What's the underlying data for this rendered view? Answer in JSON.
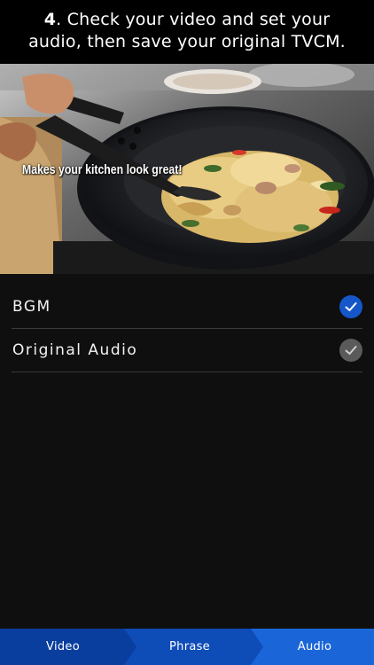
{
  "header": {
    "step_number": "4",
    "line1_rest": ". Check your video and set your",
    "line2": "audio, then save your original TVCM."
  },
  "video": {
    "caption": "Makes your kitchen look great!"
  },
  "audio_options": [
    {
      "label": "BGM",
      "checked": true
    },
    {
      "label": "Original Audio",
      "checked": false
    }
  ],
  "tabs": [
    {
      "label": "Video",
      "active": false
    },
    {
      "label": "Phrase",
      "active": false
    },
    {
      "label": "Audio",
      "active": true
    }
  ],
  "colors": {
    "accent_blue": "#1557c9",
    "tab_dark": "#0a3e9e",
    "tab_mid": "#0e4cb8",
    "tab_active": "#1a66d9",
    "unchecked_gray": "#5a5a5a"
  }
}
